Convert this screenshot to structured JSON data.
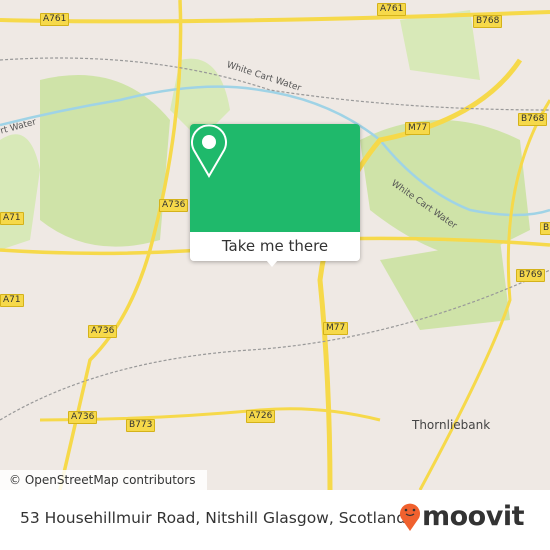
{
  "map": {
    "road_shields": [
      {
        "ref": "A761"
      },
      {
        "ref": "A761"
      },
      {
        "ref": "B768"
      },
      {
        "ref": "B768"
      },
      {
        "ref": "M77"
      },
      {
        "ref": "A736"
      },
      {
        "ref": "A736"
      },
      {
        "ref": "A736"
      },
      {
        "ref": "B773"
      },
      {
        "ref": "A726"
      },
      {
        "ref": "M77"
      },
      {
        "ref": "B769"
      },
      {
        "ref": "A71"
      },
      {
        "ref": "A71"
      },
      {
        "ref": "B"
      }
    ],
    "labels": {
      "river_1": "White Cart Water",
      "river_2": "White Cart Water",
      "river_3": "rt Water",
      "place_1": "Thornliebank"
    },
    "colors": {
      "land": "#efe9e4",
      "park": "#cfe3a8",
      "road": "#f6d94a",
      "water": "#9fd3e6",
      "marker": "#1fb96b"
    }
  },
  "popup": {
    "button_label": "Take me there",
    "icon": "map-pin-icon"
  },
  "attribution": "© OpenStreetMap contributors",
  "footer": {
    "address": "53 Househillmuir Road, Nitshill Glasgow, Scotland",
    "brand": "moovit",
    "brand_color": "#f0612e"
  }
}
